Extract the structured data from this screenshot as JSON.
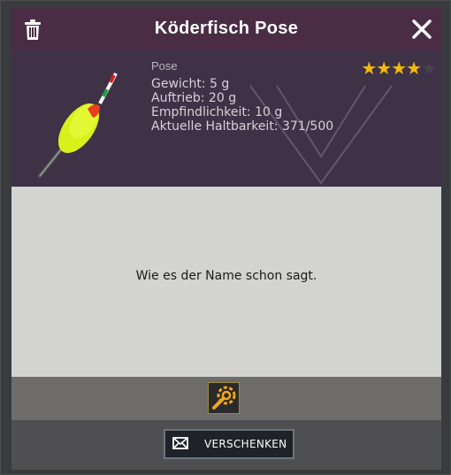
{
  "dialog": {
    "title": "Köderfisch Pose",
    "close_icon": "close-icon",
    "trash_icon": "trash-icon"
  },
  "item": {
    "type": "Pose",
    "rating": 4,
    "rating_max": 5,
    "stats": {
      "weight": "Gewicht: 5 g",
      "buoyancy": "Auftrieb: 20 g",
      "sensitivity": "Empfindlichkeit: 10 g",
      "durability": "Aktuelle Haltbarkeit: 371/500"
    },
    "image_icon": "fishing-float-icon",
    "description": "Wie es der Name schon sagt."
  },
  "toolbar": {
    "repair_icon": "repair-gear-icon"
  },
  "footer": {
    "gift_label": "VERSCHENKEN",
    "gift_icon": "envelope-icon"
  },
  "colors": {
    "title_bar": "#4a2c45",
    "star_active": "#f2b90f",
    "float_body": "#d9f01a",
    "float_top": "#e8401f"
  }
}
